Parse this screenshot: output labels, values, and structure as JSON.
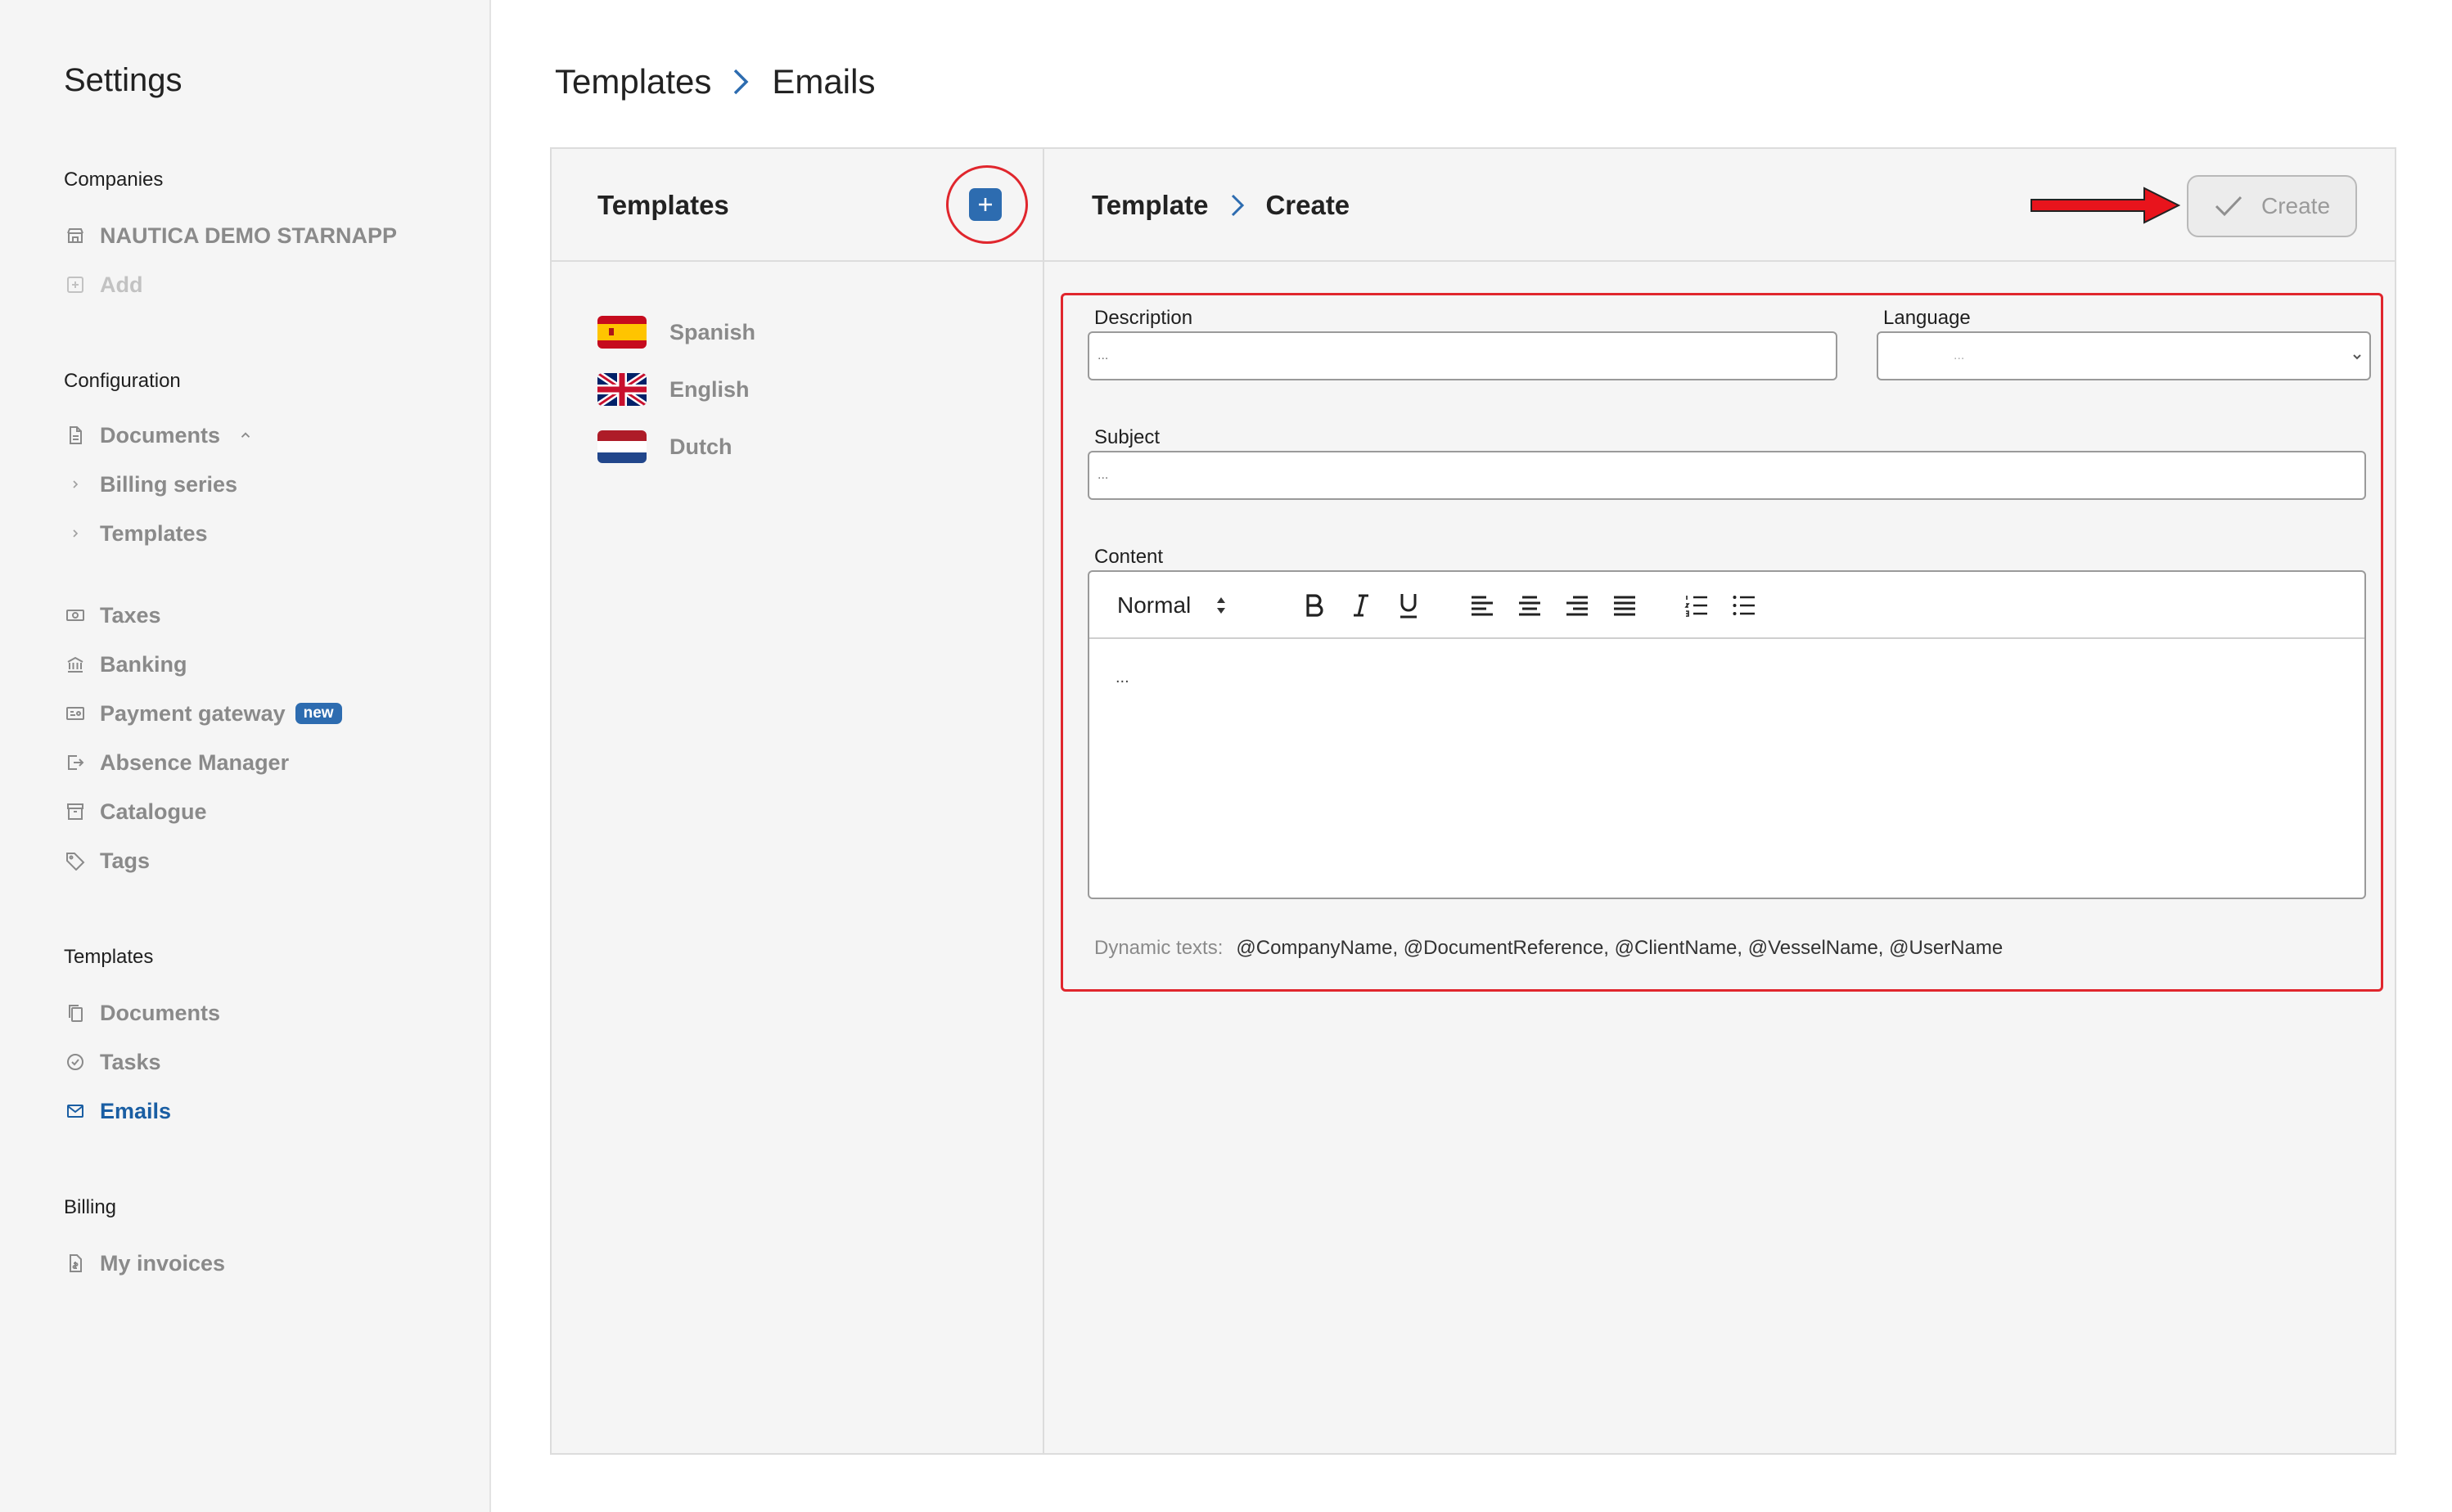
{
  "sidebar": {
    "title": "Settings",
    "sections": {
      "companies": {
        "label": "Companies",
        "items": [
          "NAUTICA DEMO STARNAPP",
          "Add"
        ]
      },
      "configuration": {
        "label": "Configuration",
        "documents": "Documents",
        "sub_items": [
          "Billing series",
          "Templates"
        ],
        "items": [
          "Taxes",
          "Banking",
          "Payment gateway",
          "Absence Manager",
          "Catalogue",
          "Tags"
        ],
        "new_badge": "new"
      },
      "templates": {
        "label": "Templates",
        "items": [
          "Documents",
          "Tasks",
          "Emails"
        ]
      },
      "billing": {
        "label": "Billing",
        "items": [
          "My invoices"
        ]
      }
    },
    "active_item": "Emails",
    "accent_color": "#1a5ea3",
    "badge_color": "#2d6cb0"
  },
  "breadcrumb": {
    "parent": "Templates",
    "current": "Emails"
  },
  "templates_panel": {
    "title": "Templates",
    "add_icon": "plus-icon",
    "languages": [
      {
        "name": "Spanish",
        "flag": "spain-flag-icon"
      },
      {
        "name": "English",
        "flag": "uk-flag-icon"
      },
      {
        "name": "Dutch",
        "flag": "netherlands-flag-icon"
      }
    ]
  },
  "form": {
    "breadcrumb": {
      "parent": "Template",
      "current": "Create"
    },
    "create_label": "Create",
    "description": {
      "label": "Description",
      "placeholder": "..."
    },
    "language": {
      "label": "Language",
      "value": "..."
    },
    "subject": {
      "label": "Subject",
      "placeholder": "..."
    },
    "content": {
      "label": "Content",
      "format_select": "Normal",
      "body": "...",
      "toolbar_icons": [
        "bold-icon",
        "italic-icon",
        "underline-icon",
        "align-left-icon",
        "align-center-icon",
        "align-right-icon",
        "align-justify-icon",
        "ordered-list-icon",
        "bullet-list-icon"
      ]
    },
    "dynamic_texts": {
      "label": "Dynamic texts:",
      "values": "@CompanyName, @DocumentReference, @ClientName, @VesselName, @UserName"
    }
  },
  "annotation_color": "#e0262d"
}
